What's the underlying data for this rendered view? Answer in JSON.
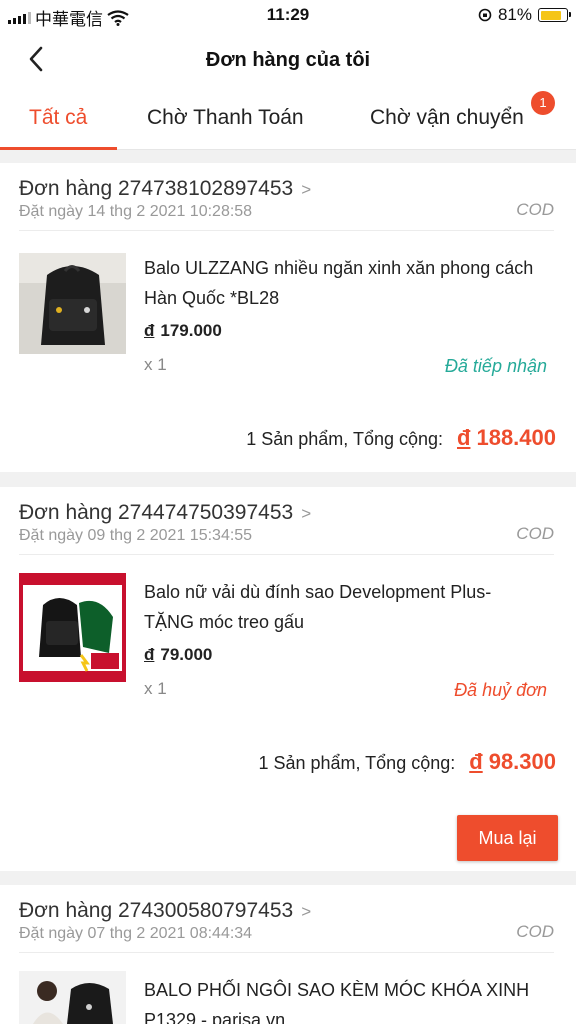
{
  "status_bar": {
    "carrier": "中華電信",
    "time": "11:29",
    "battery_percent": "81%",
    "battery_level": 0.81,
    "battery_color": "#f5c518"
  },
  "header": {
    "title": "Đơn hàng của tôi",
    "back_icon": "chevron-left-icon"
  },
  "tabs": [
    {
      "label": "Tất cả",
      "active": true
    },
    {
      "label": "Chờ Thanh Toán",
      "active": false
    },
    {
      "label": "Chờ vận chuyển",
      "active": false,
      "badge": "1"
    }
  ],
  "colors": {
    "accent": "#ee4d2d",
    "status_received": "#26aa99",
    "status_cancelled": "#ee4d2d"
  },
  "orders": [
    {
      "id_label": "Đơn hàng 274738102897453",
      "date": "Đặt ngày 14 thg 2 2021  10:28:58",
      "payment": "COD",
      "product_name": "Balo ULZZANG nhiều ngăn xinh xăn phong cách Hàn Quốc *BL28",
      "currency": "đ",
      "price": "179.000",
      "quantity": "x 1",
      "status": "Đã tiếp nhận",
      "total_label": "1 Sản phẩm, Tổng cộng:",
      "total": "188.400"
    },
    {
      "id_label": "Đơn hàng 274474750397453",
      "date": "Đặt ngày 09 thg 2 2021  15:34:55",
      "payment": "COD",
      "product_name": "Balo nữ vải dù đính sao Development Plus- TẶNG móc treo gấu",
      "currency": "đ",
      "price": "79.000",
      "quantity": "x 1",
      "status": "Đã huỷ đơn",
      "total_label": "1 Sản phẩm, Tổng cộng:",
      "total": "98.300",
      "action_label": "Mua lại"
    },
    {
      "id_label": "Đơn hàng 274300580797453",
      "date": "Đặt ngày 07 thg 2 2021  08:44:34",
      "payment": "COD",
      "product_name": "BALO PHỐI NGÔI SAO KÈM MÓC KHÓA XINH P1329 - parisa.vn"
    }
  ]
}
